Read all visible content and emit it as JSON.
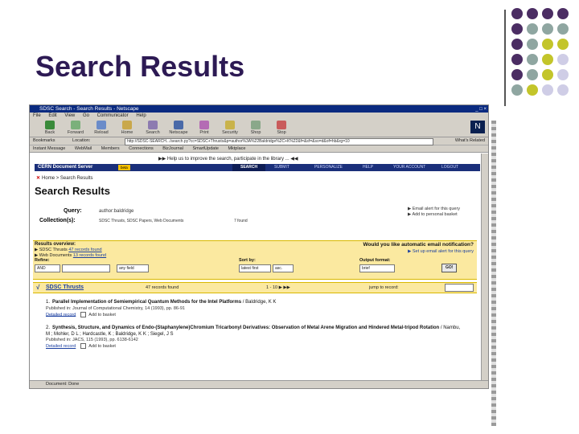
{
  "slide": {
    "title": "Search Results",
    "dot_colors": {
      "purple": "#4b2d63",
      "sage": "#8fa6a1",
      "olive": "#c3c52a",
      "lavender": "#cfcde6"
    }
  },
  "browser": {
    "window_title": "SDSC Search - Search Results - Netscape",
    "window_buttons": "_ □ ×",
    "menu": [
      "File",
      "Edit",
      "View",
      "Go",
      "Communicator",
      "Help"
    ],
    "toolbar": [
      "Back",
      "Forward",
      "Reload",
      "Home",
      "Search",
      "Netscape",
      "Print",
      "Security",
      "Shop",
      "Stop"
    ],
    "location_label": "Bookmarks",
    "location_sublabel": "Location:",
    "url": "http://SDSC-SEARCH.../search.py?cc=SDSC+Thrusts&p=author%3A%22Baldridge%2C+K%22&f=&sf=&so=d&of=hb&rg=10",
    "related": "What's Related",
    "bookmarks": [
      "Instant Message",
      "WebMail",
      "Members",
      "Connections",
      "BizJournal",
      "SmartUpdate",
      "Mktplace"
    ],
    "status": "Document: Done"
  },
  "page": {
    "help_line": "▶▶ Help us to improve the search, participate in the library ... ◀◀",
    "cern_logo": "CERN Document Server",
    "cern_badge": "beta",
    "nav": [
      "SEARCH",
      "SUBMIT",
      "PERSONALIZE",
      "HELP",
      "YOUR ACCOUNT",
      "LOGOUT"
    ],
    "breadcrumb": "Home > Search Results",
    "heading": "Search Results",
    "query_label": "Query:",
    "query_value": "author:baldridge",
    "collections_label": "Collection(s):",
    "collections_value": "SDSC Thrusts, SDSC Papers, Web Documents",
    "collections_any": "7 found",
    "alert_links": [
      "▶ Email alert for this query",
      "▶ Add to personal basket"
    ],
    "overview_title": "Results overview:",
    "overview_lines": [
      {
        "prefix": "▶ SDSC Thrusts ",
        "link": "47 records found"
      },
      {
        "prefix": "▶ Web Documents ",
        "link": "13 records found"
      }
    ],
    "email_question": "Would you like automatic email notification?",
    "email_link": "▶ Set up email alert for this query",
    "refine_label": "Refine:",
    "refine_op": "AND",
    "refine_field": "any field",
    "sortby_label": "Sort by:",
    "sort_field": "latest first",
    "sort_order": "asc.",
    "format_label": "Output format:",
    "format_value": "brief",
    "go_label": "GO!",
    "collection_bar": {
      "check": "√",
      "name": "SDSC Thrusts",
      "count": "47 records found",
      "pages": "1 - 10 ▶ ▶▶",
      "jump": "jump to record:"
    },
    "records": [
      {
        "num": "1.",
        "title": "Parallel Implementation of Semiempirical Quantum Methods for the Intel Platforms",
        "authors": " / Baldridge, K K",
        "source": "Published in: Journal of Computational Chemistry, 14 (1993), pp. 86-91",
        "detail": "Detailed record",
        "basket": "Add to basket"
      },
      {
        "num": "2.",
        "title": "Synthesis, Structure, and Dynamics of Endo-(Staphanylene)Chromium Tricarbonyl Derivatives: Observation of Metal Arene Migration and Hindered Metal-tripod Rotation",
        "authors": " / Nambu, M ; Mohler, D L ; Hardcastle, K ; Baldridge, K K ; Siegel, J S",
        "source": "Published in: JACS, 115 (1993), pp. 6138-6142",
        "detail": "Detailed record",
        "basket": "Add to basket"
      }
    ]
  }
}
